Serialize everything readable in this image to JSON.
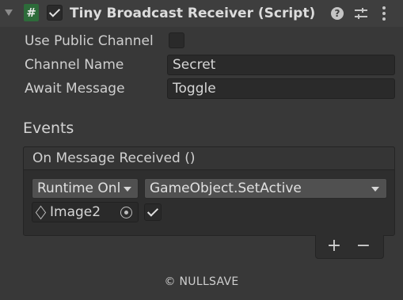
{
  "component": {
    "title": "Tiny Broadcast Receiver (Script)",
    "enabled": true,
    "icon": "csharp-script-icon",
    "header_icons": [
      "help-icon",
      "preset-sliders-icon",
      "kebab-menu-icon"
    ]
  },
  "properties": [
    {
      "label": "Use Public Channel",
      "type": "toggle",
      "value": false
    },
    {
      "label": "Channel Name",
      "type": "text",
      "value": "Secret"
    },
    {
      "label": "Await Message",
      "type": "text",
      "value": "Toggle"
    }
  ],
  "events": {
    "section_title": "Events",
    "event_name": "On Message Received ()",
    "listener": {
      "runtime_mode": "Runtime Onl",
      "function": "GameObject.SetActive",
      "target_object": "Image2",
      "argument_checked": true
    },
    "add_label": "+",
    "remove_label": "−"
  },
  "footer": {
    "text": "© NULLSAVE"
  },
  "colors": {
    "background": "#383838",
    "header": "#3e3e3e",
    "script_icon": "#2d6b3a",
    "field": "#2a2a2a"
  }
}
